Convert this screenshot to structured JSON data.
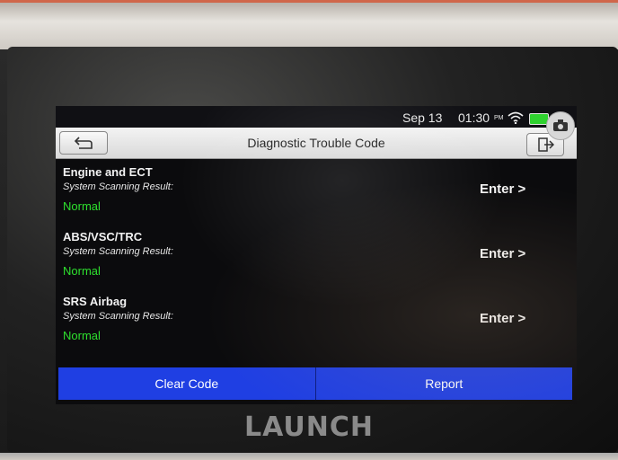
{
  "status_bar": {
    "date": "Sep 13",
    "time": "01:30",
    "ampm": "PM",
    "wifi_icon": "wifi-icon",
    "battery_icon": "battery-icon",
    "battery_color": "#2fd12f"
  },
  "header": {
    "title": "Diagnostic Trouble Code",
    "back_icon": "back-arrow-icon",
    "exit_icon": "exit-icon",
    "camera_icon": "camera-icon"
  },
  "systems": [
    {
      "name": "Engine and ECT",
      "label": "System Scanning Result:",
      "status": "Normal",
      "enter": "Enter >"
    },
    {
      "name": "ABS/VSC/TRC",
      "label": "System Scanning Result:",
      "status": "Normal",
      "enter": "Enter >"
    },
    {
      "name": "SRS Airbag",
      "label": "System Scanning Result:",
      "status": "Normal",
      "enter": "Enter >"
    }
  ],
  "footer": {
    "clear_code": "Clear Code",
    "report": "Report",
    "button_color": "#1f3fe3"
  },
  "device": {
    "brand": "LAUNCH"
  },
  "colors": {
    "status_normal": "#2ee02e",
    "titlebar": "#e6e6e6"
  }
}
